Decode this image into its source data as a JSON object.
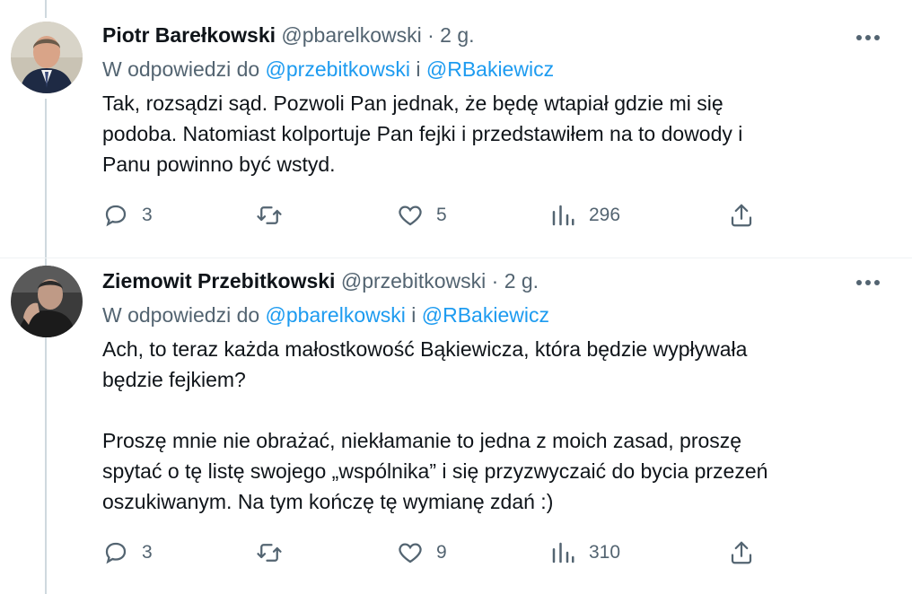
{
  "tweets": [
    {
      "author_name": "Piotr Barełkowski",
      "author_handle": "@pbarelkowski",
      "separator": "·",
      "time": "2 g.",
      "reply_prefix": "W odpowiedzi do",
      "reply_mention_1": "@przebitkowski",
      "reply_joiner": "i",
      "reply_mention_2": "@RBakiewicz",
      "text_lines": [
        "Tak, rozsądzi sąd. Pozwoli Pan jednak, że będę wtapiał gdzie mi się",
        "podoba. Natomiast kolportuje Pan fejki i przedstawiłem na to dowody i",
        "Panu powinno być wstyd."
      ],
      "replies": "3",
      "retweets": "",
      "likes": "5",
      "views": "296"
    },
    {
      "author_name": "Ziemowit Przebitkowski",
      "author_handle": "@przebitkowski",
      "separator": "·",
      "time": "2 g.",
      "reply_prefix": "W odpowiedzi do",
      "reply_mention_1": "@pbarelkowski",
      "reply_joiner": "i",
      "reply_mention_2": "@RBakiewicz",
      "text_lines": [
        "Ach, to teraz każda małostkowość Bąkiewicza, która będzie wypływała",
        "będzie fejkiem?",
        "",
        "Proszę mnie nie obrażać, niekłamanie to jedna z moich zasad, proszę",
        "spytać o tę listę swojego „wspólnika” i się przyzwyczaić do bycia przezeń",
        "oszukiwanym. Na tym kończę tę wymianę zdań :)"
      ],
      "replies": "3",
      "retweets": "",
      "likes": "9",
      "views": "310"
    }
  ],
  "icons": {
    "reply": "reply-icon",
    "retweet": "retweet-icon",
    "like": "heart-icon",
    "views": "views-icon",
    "share": "share-icon",
    "more": "more-icon"
  },
  "colors": {
    "text": "#0f1419",
    "secondary": "#536471",
    "link": "#1d9bf0",
    "thread_line": "#cfd9de"
  }
}
